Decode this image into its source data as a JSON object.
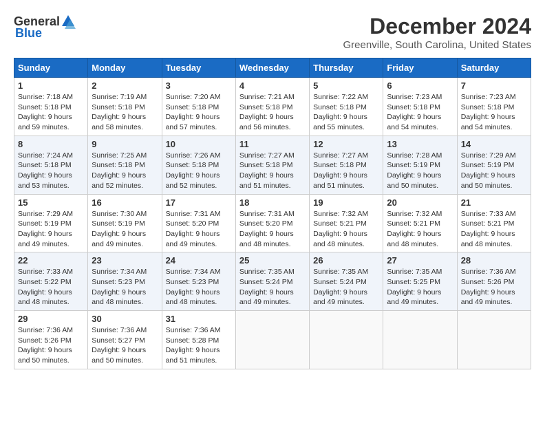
{
  "logo": {
    "general": "General",
    "blue": "Blue"
  },
  "title": "December 2024",
  "location": "Greenville, South Carolina, United States",
  "days_of_week": [
    "Sunday",
    "Monday",
    "Tuesday",
    "Wednesday",
    "Thursday",
    "Friday",
    "Saturday"
  ],
  "weeks": [
    [
      {
        "day": "1",
        "sunrise": "7:18 AM",
        "sunset": "5:18 PM",
        "daylight": "9 hours and 59 minutes."
      },
      {
        "day": "2",
        "sunrise": "7:19 AM",
        "sunset": "5:18 PM",
        "daylight": "9 hours and 58 minutes."
      },
      {
        "day": "3",
        "sunrise": "7:20 AM",
        "sunset": "5:18 PM",
        "daylight": "9 hours and 57 minutes."
      },
      {
        "day": "4",
        "sunrise": "7:21 AM",
        "sunset": "5:18 PM",
        "daylight": "9 hours and 56 minutes."
      },
      {
        "day": "5",
        "sunrise": "7:22 AM",
        "sunset": "5:18 PM",
        "daylight": "9 hours and 55 minutes."
      },
      {
        "day": "6",
        "sunrise": "7:23 AM",
        "sunset": "5:18 PM",
        "daylight": "9 hours and 54 minutes."
      },
      {
        "day": "7",
        "sunrise": "7:23 AM",
        "sunset": "5:18 PM",
        "daylight": "9 hours and 54 minutes."
      }
    ],
    [
      {
        "day": "8",
        "sunrise": "7:24 AM",
        "sunset": "5:18 PM",
        "daylight": "9 hours and 53 minutes."
      },
      {
        "day": "9",
        "sunrise": "7:25 AM",
        "sunset": "5:18 PM",
        "daylight": "9 hours and 52 minutes."
      },
      {
        "day": "10",
        "sunrise": "7:26 AM",
        "sunset": "5:18 PM",
        "daylight": "9 hours and 52 minutes."
      },
      {
        "day": "11",
        "sunrise": "7:27 AM",
        "sunset": "5:18 PM",
        "daylight": "9 hours and 51 minutes."
      },
      {
        "day": "12",
        "sunrise": "7:27 AM",
        "sunset": "5:18 PM",
        "daylight": "9 hours and 51 minutes."
      },
      {
        "day": "13",
        "sunrise": "7:28 AM",
        "sunset": "5:19 PM",
        "daylight": "9 hours and 50 minutes."
      },
      {
        "day": "14",
        "sunrise": "7:29 AM",
        "sunset": "5:19 PM",
        "daylight": "9 hours and 50 minutes."
      }
    ],
    [
      {
        "day": "15",
        "sunrise": "7:29 AM",
        "sunset": "5:19 PM",
        "daylight": "9 hours and 49 minutes."
      },
      {
        "day": "16",
        "sunrise": "7:30 AM",
        "sunset": "5:19 PM",
        "daylight": "9 hours and 49 minutes."
      },
      {
        "day": "17",
        "sunrise": "7:31 AM",
        "sunset": "5:20 PM",
        "daylight": "9 hours and 49 minutes."
      },
      {
        "day": "18",
        "sunrise": "7:31 AM",
        "sunset": "5:20 PM",
        "daylight": "9 hours and 48 minutes."
      },
      {
        "day": "19",
        "sunrise": "7:32 AM",
        "sunset": "5:21 PM",
        "daylight": "9 hours and 48 minutes."
      },
      {
        "day": "20",
        "sunrise": "7:32 AM",
        "sunset": "5:21 PM",
        "daylight": "9 hours and 48 minutes."
      },
      {
        "day": "21",
        "sunrise": "7:33 AM",
        "sunset": "5:21 PM",
        "daylight": "9 hours and 48 minutes."
      }
    ],
    [
      {
        "day": "22",
        "sunrise": "7:33 AM",
        "sunset": "5:22 PM",
        "daylight": "9 hours and 48 minutes."
      },
      {
        "day": "23",
        "sunrise": "7:34 AM",
        "sunset": "5:23 PM",
        "daylight": "9 hours and 48 minutes."
      },
      {
        "day": "24",
        "sunrise": "7:34 AM",
        "sunset": "5:23 PM",
        "daylight": "9 hours and 48 minutes."
      },
      {
        "day": "25",
        "sunrise": "7:35 AM",
        "sunset": "5:24 PM",
        "daylight": "9 hours and 49 minutes."
      },
      {
        "day": "26",
        "sunrise": "7:35 AM",
        "sunset": "5:24 PM",
        "daylight": "9 hours and 49 minutes."
      },
      {
        "day": "27",
        "sunrise": "7:35 AM",
        "sunset": "5:25 PM",
        "daylight": "9 hours and 49 minutes."
      },
      {
        "day": "28",
        "sunrise": "7:36 AM",
        "sunset": "5:26 PM",
        "daylight": "9 hours and 49 minutes."
      }
    ],
    [
      {
        "day": "29",
        "sunrise": "7:36 AM",
        "sunset": "5:26 PM",
        "daylight": "9 hours and 50 minutes."
      },
      {
        "day": "30",
        "sunrise": "7:36 AM",
        "sunset": "5:27 PM",
        "daylight": "9 hours and 50 minutes."
      },
      {
        "day": "31",
        "sunrise": "7:36 AM",
        "sunset": "5:28 PM",
        "daylight": "9 hours and 51 minutes."
      },
      null,
      null,
      null,
      null
    ]
  ]
}
